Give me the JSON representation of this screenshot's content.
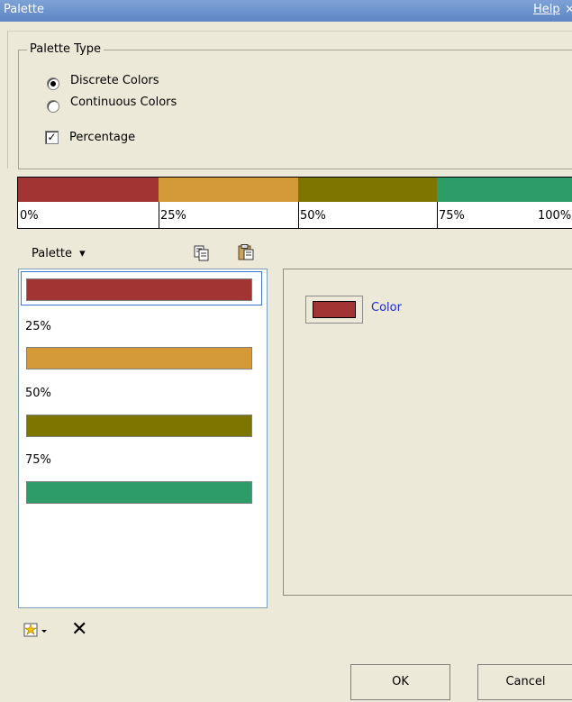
{
  "window": {
    "title": "Palette",
    "help_label": "Help",
    "close_glyph": "×"
  },
  "palette_type": {
    "group_label": "Palette Type",
    "options": [
      {
        "label": "Discrete Colors",
        "selected": true
      },
      {
        "label": "Continuous Colors",
        "selected": false
      }
    ],
    "percentage": {
      "label": "Percentage",
      "checked": true,
      "check_glyph": "✓"
    }
  },
  "palette_bar": {
    "segments": [
      {
        "color": "#a33434"
      },
      {
        "color": "#d49a38"
      },
      {
        "color": "#857f00"
      },
      {
        "color": "#2e9c69"
      }
    ],
    "labels": [
      "0%",
      "25%",
      "50%",
      "75%",
      "100%"
    ]
  },
  "toolbar": {
    "palette_menu_label": "Palette",
    "dropdown_glyph": "▾",
    "copy_icon": "copy-icon",
    "paste_icon": "paste-icon"
  },
  "palette_list": {
    "items": [
      {
        "color": "#a33434"
      },
      {
        "label": "25%",
        "color": "#d49a38"
      },
      {
        "label": "50%",
        "color": "#857f00"
      },
      {
        "label": "75%",
        "color": "#2e9c69"
      }
    ],
    "selected_index": 0
  },
  "properties": {
    "color_label": "Color",
    "selected_color": "#a33434"
  },
  "bottom": {
    "add_icon": "add-entry-icon",
    "delete_glyph": "✕",
    "ok_label": "OK",
    "cancel_label": "Cancel"
  }
}
